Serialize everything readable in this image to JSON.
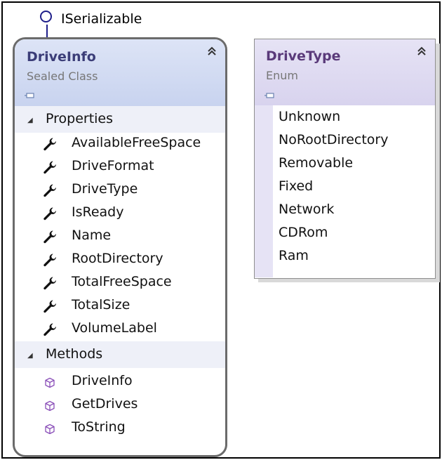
{
  "interface": {
    "label": "ISerializable"
  },
  "driveinfo": {
    "name": "DriveInfo",
    "kind": "Sealed Class",
    "properties_label": "Properties",
    "properties": [
      "AvailableFreeSpace",
      "DriveFormat",
      "DriveType",
      "IsReady",
      "Name",
      "RootDirectory",
      "TotalFreeSpace",
      "TotalSize",
      "VolumeLabel"
    ],
    "methods_label": "Methods",
    "methods": [
      "DriveInfo",
      "GetDrives",
      "ToString"
    ]
  },
  "drivetype": {
    "name": "DriveType",
    "kind": "Enum",
    "values": [
      "Unknown",
      "NoRootDirectory",
      "Removable",
      "Fixed",
      "Network",
      "CDRom",
      "Ram"
    ]
  },
  "icons": {
    "property": "wrench-icon",
    "method": "cube-icon",
    "collapse": "double-chevron-up-icon",
    "section": "triangle-expanded-icon"
  },
  "colors": {
    "header_driveinfo": "#c8d3ef",
    "header_drivetype": "#d8d3ee",
    "lollipop": "#1f1f8a",
    "method_icon": "#8a4fb8"
  }
}
